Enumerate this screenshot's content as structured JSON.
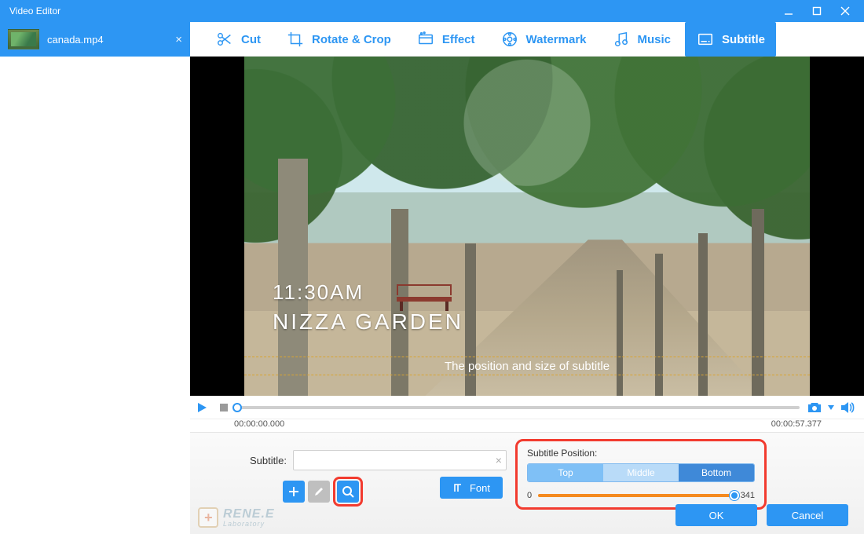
{
  "window": {
    "title": "Video Editor"
  },
  "sidebar": {
    "file_name": "canada.mp4"
  },
  "toolbar": {
    "cut": "Cut",
    "rotate_crop": "Rotate & Crop",
    "effect": "Effect",
    "watermark": "Watermark",
    "music": "Music",
    "subtitle": "Subtitle"
  },
  "preview": {
    "overlay_time": "11:30AM",
    "overlay_place": "NIZZA GARDEN",
    "subtitle_sample": "The position and size of subtitle"
  },
  "playback": {
    "time_start": "00:00:00.000",
    "time_end": "00:00:57.377"
  },
  "subtitle_panel": {
    "input_label": "Subtitle:",
    "input_value": "",
    "font_button": "Font"
  },
  "position_panel": {
    "label": "Subtitle Position:",
    "options": {
      "top": "Top",
      "middle": "Middle",
      "bottom": "Bottom"
    },
    "slider_min": "0",
    "slider_value": "341"
  },
  "dialog": {
    "ok": "OK",
    "cancel": "Cancel"
  },
  "brand": {
    "line1": "RENE.E",
    "line2": "Laboratory"
  }
}
